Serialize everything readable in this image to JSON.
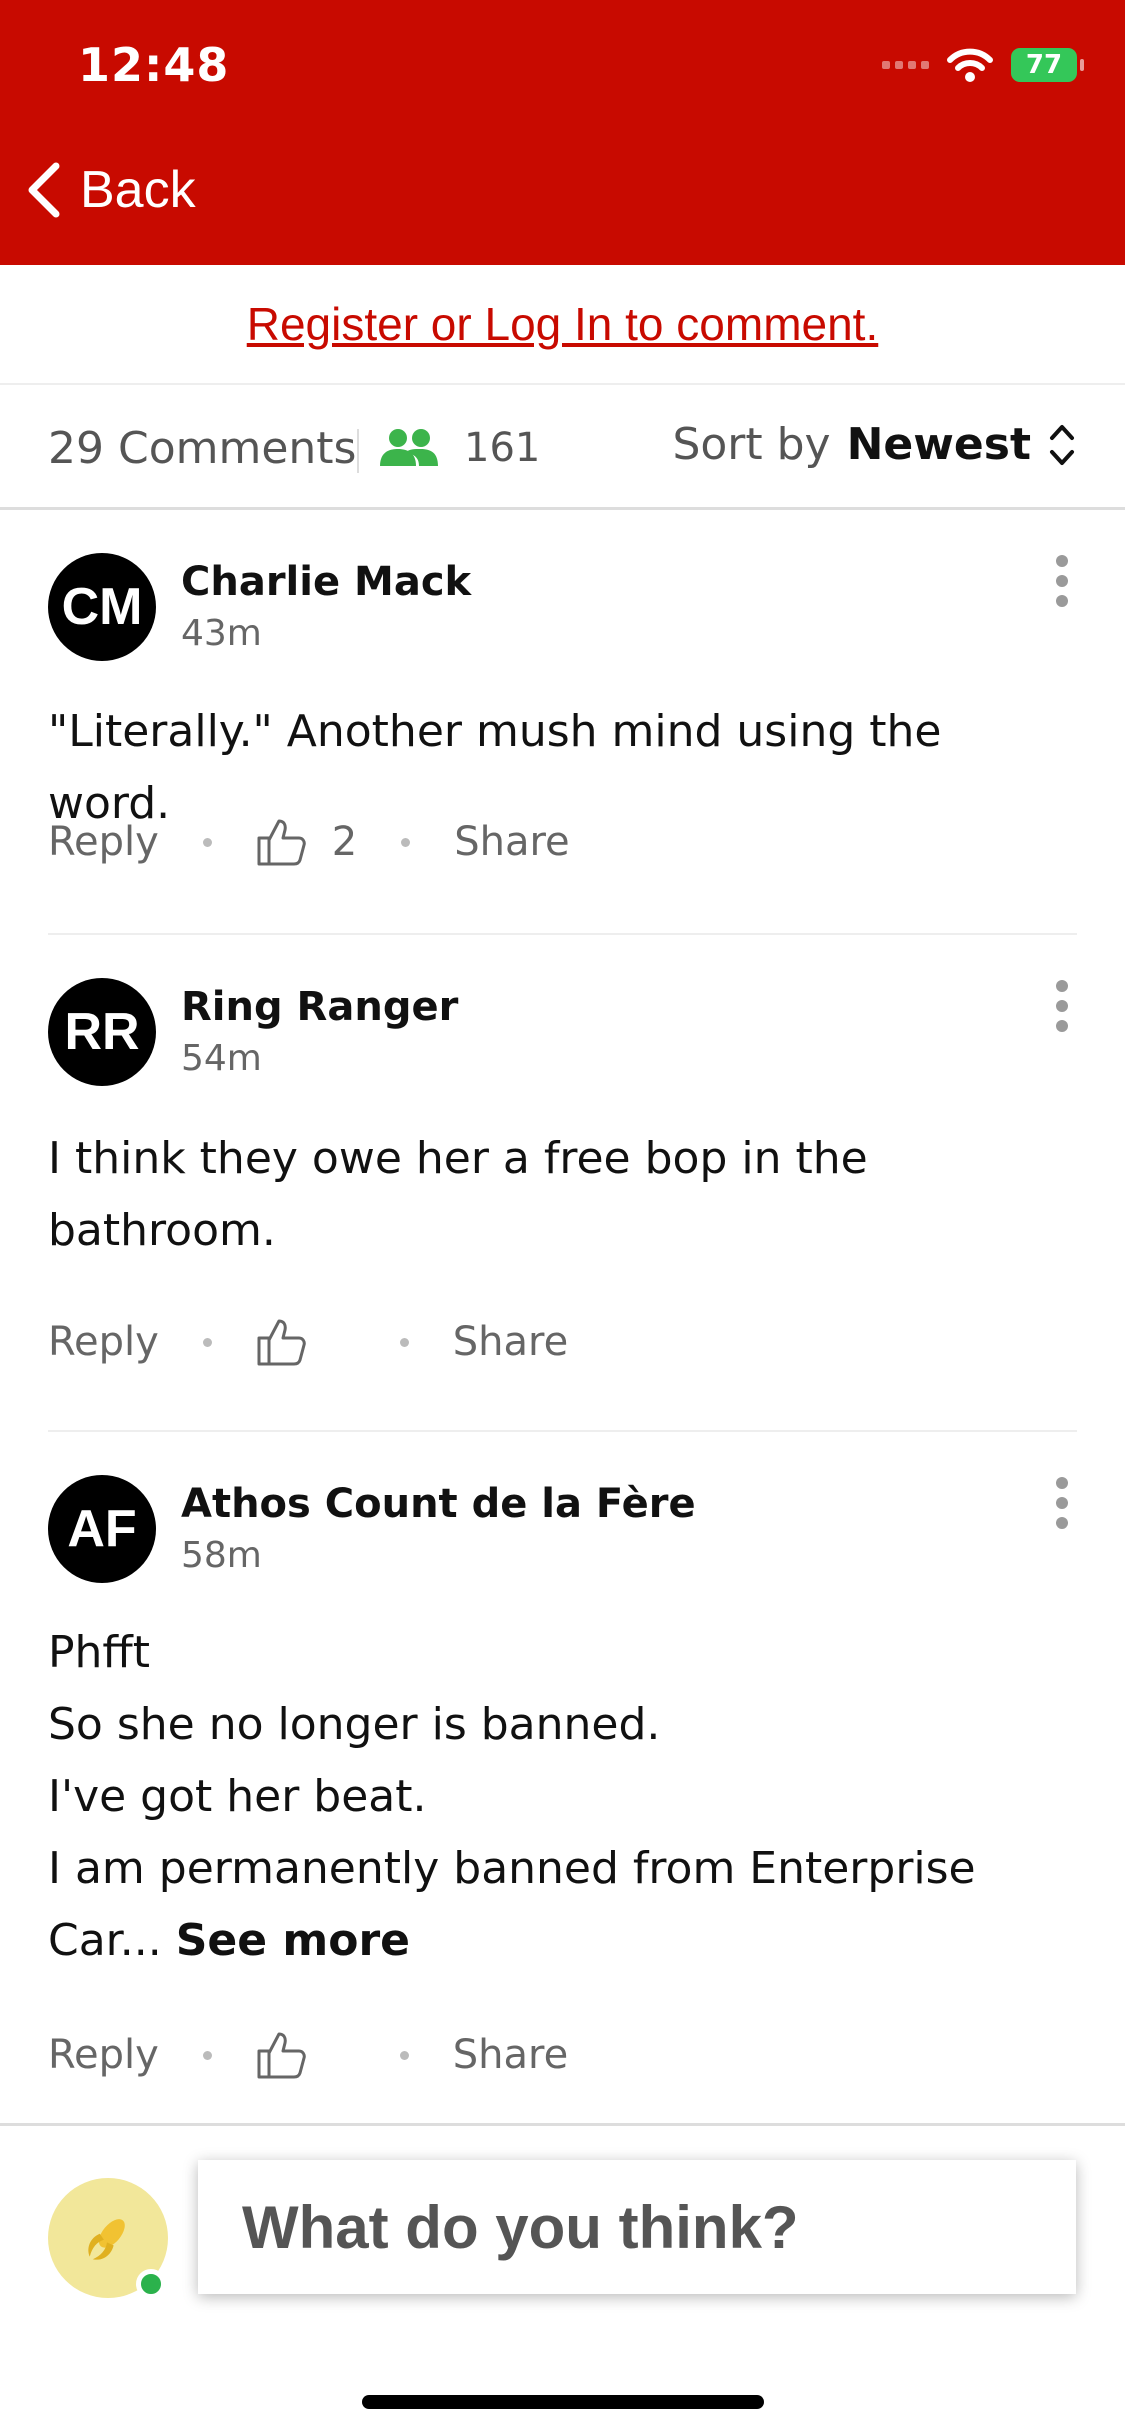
{
  "status_bar": {
    "time": "12:48",
    "battery": "77"
  },
  "nav": {
    "back_label": "Back"
  },
  "login": {
    "link_text": "Register or Log In to comment."
  },
  "comments_header": {
    "count_label": "29 Comments",
    "viewer_count": "161",
    "sort_label": "Sort by",
    "sort_value": "Newest"
  },
  "comments": [
    {
      "initials": "CM",
      "author": "Charlie Mack",
      "time": "43m",
      "lines": [
        "\"Literally.\" Another mush mind using the word."
      ],
      "reply_label": "Reply",
      "likes": "2",
      "share_label": "Share"
    },
    {
      "initials": "RR",
      "author": "Ring Ranger",
      "time": "54m",
      "lines": [
        "I think they owe her a free bop in the",
        "bathroom."
      ],
      "reply_label": "Reply",
      "likes": "",
      "share_label": "Share"
    },
    {
      "initials": "AF",
      "author": "Athos Count de la Fère",
      "time": "58m",
      "lines": [
        "Phfft",
        "So she no longer is banned.",
        "I've got her beat.",
        "I am permanently banned from Enterprise",
        "Car..."
      ],
      "see_more": "See more",
      "reply_label": "Reply",
      "likes": "",
      "share_label": "Share"
    }
  ],
  "composer": {
    "placeholder": "What do you think?"
  },
  "colors": {
    "brand": "#c80a00",
    "online": "#2bb24c",
    "viewers_icon": "#3cb44b",
    "battery": "#34c759"
  },
  "icons": [
    "back-chevron-icon",
    "wifi-icon",
    "battery-icon",
    "users-icon",
    "sort-updown-icon",
    "more-vertical-icon",
    "thumbs-up-icon",
    "corn-icon"
  ]
}
